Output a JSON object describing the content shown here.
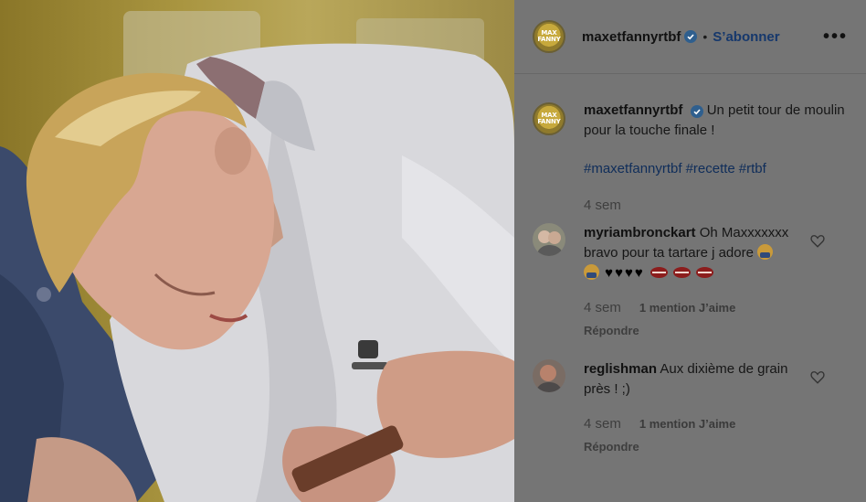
{
  "header": {
    "username": "maxetfannyrtbf",
    "follow_label": "S’abonner",
    "separator": "•",
    "more_label": "•••",
    "logo_text": "MAX FANNY"
  },
  "caption": {
    "username": "maxetfannyrtbf",
    "text": "Un petit tour de moulin pour la touche finale !",
    "hashtags": [
      "#maxetfannyrtbf",
      "#recette",
      "#rtbf"
    ],
    "time": "4 sem"
  },
  "comments": [
    {
      "username": "myriambronckart",
      "text": "Oh Maxxxxxxx bravo pour ta tartare j adore",
      "time": "4 sem",
      "likes": "1 mention J’aime",
      "reply": "Répondre"
    },
    {
      "username": "reglishman",
      "text": "Aux dixième de grain près ! ;)",
      "time": "4 sem",
      "likes": "1 mention J’aime",
      "reply": "Répondre"
    }
  ],
  "icons": {
    "verified": "verified-badge-icon",
    "heart": "heart-outline-icon",
    "more": "more-options-icon"
  },
  "colors": {
    "link": "#16386c",
    "verified": "#2f5f8e",
    "panel_bg": "#757575"
  }
}
